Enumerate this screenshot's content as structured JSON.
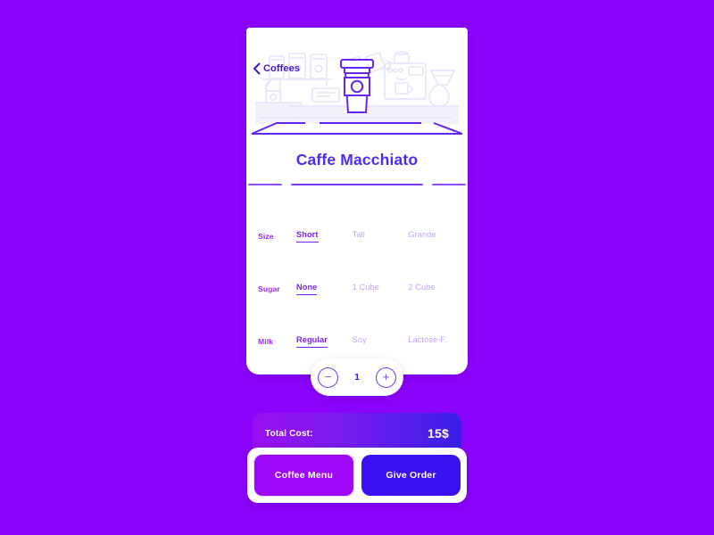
{
  "theme": {
    "background": "#8c03fb",
    "card": "#ffffff",
    "title_color": "#4f2bf0",
    "accent_purple": "#7a22f5",
    "muted_purple": "#c5a3f5",
    "label_purple": "#a12bff",
    "button_blue": "#3a10f0",
    "button_purple": "#9d09f7"
  },
  "header": {
    "back_label": "Coffees",
    "back_icon": "chevron-left-icon",
    "illustration": "coffee-shop-counter-illustration"
  },
  "product": {
    "title": "Caffe Macchiato",
    "pager": {
      "total": 3,
      "active_index": 1
    }
  },
  "options": [
    {
      "label": "Size",
      "choices": [
        {
          "text": "Short",
          "selected": true
        },
        {
          "text": "Tall",
          "selected": false
        },
        {
          "text": "Grande",
          "selected": false
        }
      ]
    },
    {
      "label": "Sugar",
      "choices": [
        {
          "text": "None",
          "selected": true
        },
        {
          "text": "1 Cube",
          "selected": false
        },
        {
          "text": "2 Cube",
          "selected": false
        }
      ]
    },
    {
      "label": "Milk",
      "choices": [
        {
          "text": "Regular",
          "selected": true
        },
        {
          "text": "Soy",
          "selected": false
        },
        {
          "text": "Lactose-F.",
          "selected": false
        }
      ]
    }
  ],
  "quantity": {
    "decrease_icon": "minus-circle-icon",
    "increase_icon": "plus-circle-icon",
    "value": "1",
    "minus_glyph": "−",
    "plus_glyph": "+"
  },
  "purchase": {
    "total_label": "Total Cost:",
    "total_value": "15$",
    "menu_button": "Coffee Menu",
    "order_button": "Give Order"
  }
}
